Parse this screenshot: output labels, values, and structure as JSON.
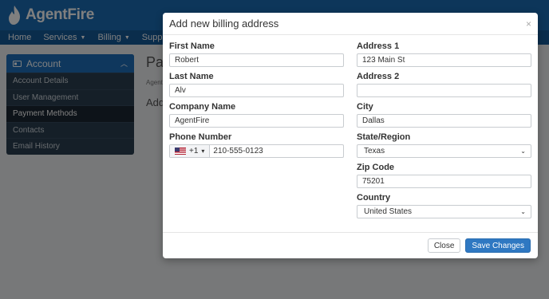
{
  "app": {
    "logo_text": "AgentFire"
  },
  "nav": [
    {
      "label": "Home",
      "caret": false
    },
    {
      "label": "Services",
      "caret": true
    },
    {
      "label": "Billing",
      "caret": true
    },
    {
      "label": "Support",
      "caret": true
    }
  ],
  "sidebar": {
    "header": "Account",
    "items": [
      {
        "label": "Account Details"
      },
      {
        "label": "User Management"
      },
      {
        "label": "Payment Methods",
        "active": true
      },
      {
        "label": "Contacts"
      },
      {
        "label": "Email History"
      }
    ]
  },
  "page": {
    "title": "Pay",
    "breadcrumb": "Agent",
    "section": "Add"
  },
  "modal": {
    "title": "Add new billing address",
    "close_glyph": "×",
    "fields": {
      "first_name": {
        "label": "First Name",
        "value": "Robert"
      },
      "last_name": {
        "label": "Last Name",
        "value": "Alv"
      },
      "company": {
        "label": "Company Name",
        "value": "AgentFire"
      },
      "phone": {
        "label": "Phone Number",
        "country_code": "+1",
        "value": "210-555-0123"
      },
      "address1": {
        "label": "Address 1",
        "value": "123 Main St"
      },
      "address2": {
        "label": "Address 2",
        "value": ""
      },
      "city": {
        "label": "City",
        "value": "Dallas"
      },
      "state": {
        "label": "State/Region",
        "value": "Texas"
      },
      "zip": {
        "label": "Zip Code",
        "value": "75201"
      },
      "country": {
        "label": "Country",
        "value": "United States"
      }
    },
    "buttons": {
      "close": "Close",
      "save": "Save Changes"
    }
  },
  "colors": {
    "brand": "#1b6cb5",
    "nav": "#155a99",
    "primary_button": "#2f78c2",
    "sidebar_bg": "#2b3e50"
  },
  "icons": [
    "flame-logo-icon",
    "caret-down-icon",
    "id-card-icon",
    "chevron-up-icon",
    "close-icon",
    "us-flag-icon"
  ]
}
